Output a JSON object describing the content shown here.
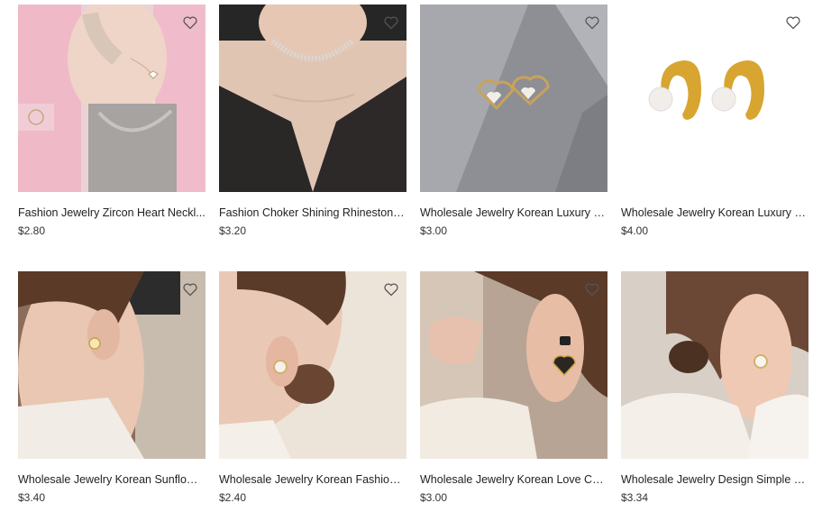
{
  "products": [
    {
      "title": "Fashion Jewelry Zircon Heart Neckl...",
      "price": "$2.80",
      "icon": "heart-outline"
    },
    {
      "title": "Fashion Choker Shining Rhinestone ...",
      "price": "$3.20",
      "icon": "heart-outline"
    },
    {
      "title": "Wholesale Jewelry Korean Luxury L...",
      "price": "$3.00",
      "icon": "heart-outline"
    },
    {
      "title": "Wholesale Jewelry Korean Luxury D...",
      "price": "$4.00",
      "icon": "heart-outline"
    },
    {
      "title": "Wholesale Jewelry Korean Sunflowe...",
      "price": "$3.40",
      "icon": "heart-outline"
    },
    {
      "title": "Wholesale Jewelry Korean Fashion ...",
      "price": "$2.40",
      "icon": "heart-outline"
    },
    {
      "title": "Wholesale Jewelry Korean Love Cut...",
      "price": "$3.00",
      "icon": "heart-outline"
    },
    {
      "title": "Wholesale Jewelry Design Simple K...",
      "price": "$3.34",
      "icon": "heart-outline"
    }
  ]
}
